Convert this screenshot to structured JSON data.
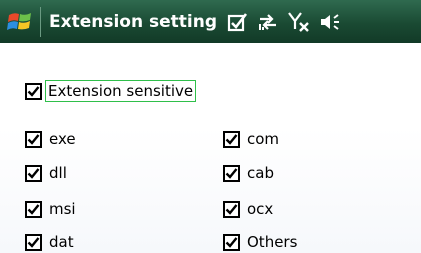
{
  "title": "Extension setting",
  "icons": {
    "start": "windows-flag-icon",
    "edit": "edit-checkbox-icon",
    "connectivity": "connectivity-arrows-icon",
    "signal": "no-signal-icon",
    "volume": "volume-icon"
  },
  "sensitive": {
    "label": "Extension sensitive",
    "checked": true
  },
  "extensions_left": [
    {
      "label": "exe",
      "checked": true
    },
    {
      "label": "dll",
      "checked": true
    },
    {
      "label": "msi",
      "checked": true
    },
    {
      "label": "dat",
      "checked": true
    }
  ],
  "extensions_right": [
    {
      "label": "com",
      "checked": true
    },
    {
      "label": "cab",
      "checked": true
    },
    {
      "label": "ocx",
      "checked": true
    },
    {
      "label": "Others",
      "checked": true
    }
  ],
  "colors": {
    "titlebar": "#1a4a33",
    "focus_border": "#2fbf4a"
  }
}
